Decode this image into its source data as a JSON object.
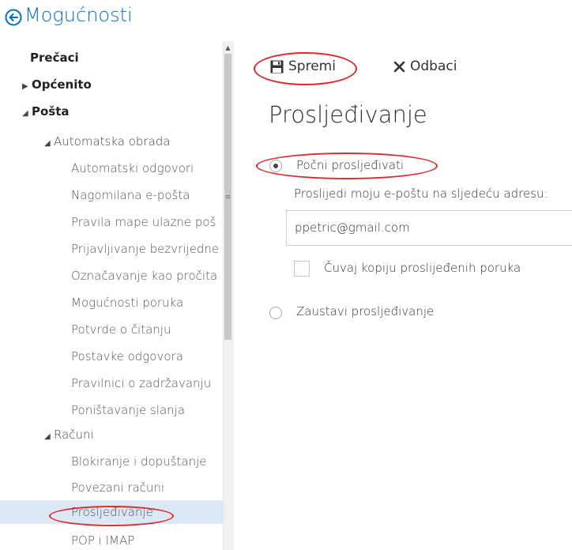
{
  "header": {
    "title": "Mogućnosti"
  },
  "sidebar": {
    "items": [
      {
        "label": "Prečaci"
      },
      {
        "label": "Općenito"
      },
      {
        "label": "Pošta"
      },
      {
        "label": "Automatska obrada"
      },
      {
        "label": "Automatski odgovori"
      },
      {
        "label": "Nagomilana e-pošta"
      },
      {
        "label": "Pravila mape ulazne poš"
      },
      {
        "label": "Prijavljivanje bezvrijedne"
      },
      {
        "label": "Označavanje kao pročita"
      },
      {
        "label": "Mogućnosti poruka"
      },
      {
        "label": "Potvrde o čitanju"
      },
      {
        "label": "Postavke odgovora"
      },
      {
        "label": "Pravilnici o zadržavanju"
      },
      {
        "label": "Poništavanje slanja"
      },
      {
        "label": "Računi"
      },
      {
        "label": "Blokiranje i dopuštanje"
      },
      {
        "label": "Povezani računi"
      },
      {
        "label": "Prosljeđivanje"
      },
      {
        "label": "POP i IMAP"
      }
    ]
  },
  "toolbar": {
    "save_label": "Spremi",
    "discard_label": "Odbaci"
  },
  "main": {
    "title": "Prosljeđivanje",
    "start_forwarding_label": "Počni prosljeđivati",
    "forward_to_label": "Proslijedi moju e-poštu na sljedeću adresu:",
    "forward_address": "ppetric@gmail.com",
    "keep_copy_label": "Čuvaj kopiju proslijeđenih poruka",
    "stop_forwarding_label": "Zaustavi prosljeđivanje"
  },
  "colors": {
    "accent": "#0072c6",
    "selected_bg": "#dbe8f6",
    "annotation": "#e0292b"
  }
}
